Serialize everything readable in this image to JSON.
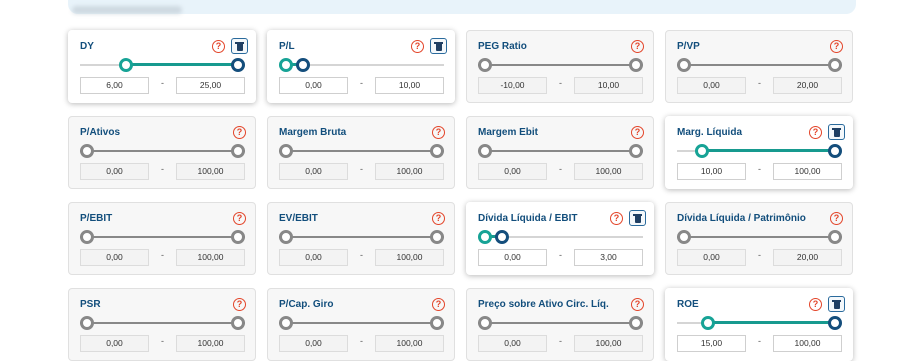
{
  "filters": [
    {
      "key": "dy",
      "name": "DY",
      "active": true,
      "min": "6,00",
      "max": "25,00",
      "lo": 0.26,
      "hi": 1.0
    },
    {
      "key": "pl",
      "name": "P/L",
      "active": true,
      "min": "0,00",
      "max": "10,00",
      "lo": 0.0,
      "hi": 0.11
    },
    {
      "key": "peg-ratio",
      "name": "PEG Ratio",
      "active": false,
      "min": "-10,00",
      "max": "10,00",
      "lo": 0,
      "hi": 1
    },
    {
      "key": "pvp",
      "name": "P/VP",
      "active": false,
      "min": "0,00",
      "max": "20,00",
      "lo": 0,
      "hi": 1
    },
    {
      "key": "p-ativos",
      "name": "P/Ativos",
      "active": false,
      "min": "0,00",
      "max": "100,00",
      "lo": 0,
      "hi": 1
    },
    {
      "key": "margem-bruta",
      "name": "Margem Bruta",
      "active": false,
      "min": "0,00",
      "max": "100,00",
      "lo": 0,
      "hi": 1
    },
    {
      "key": "margem-ebit",
      "name": "Margem Ebit",
      "active": false,
      "min": "0,00",
      "max": "100,00",
      "lo": 0,
      "hi": 1
    },
    {
      "key": "marg-liquida",
      "name": "Marg. Líquida",
      "active": true,
      "min": "10,00",
      "max": "100,00",
      "lo": 0.12,
      "hi": 1.0
    },
    {
      "key": "p-ebit",
      "name": "P/EBIT",
      "active": false,
      "min": "0,00",
      "max": "100,00",
      "lo": 0,
      "hi": 1
    },
    {
      "key": "ev-ebit",
      "name": "EV/EBIT",
      "active": false,
      "min": "0,00",
      "max": "100,00",
      "lo": 0,
      "hi": 1
    },
    {
      "key": "divida-liquida-ebit",
      "name": "Dívida Líquida / EBIT",
      "active": true,
      "min": "0,00",
      "max": "3,00",
      "lo": 0.0,
      "hi": 0.11
    },
    {
      "key": "divida-liquida-patrimonio",
      "name": "Dívida Líquida / Patrimônio",
      "active": false,
      "min": "0,00",
      "max": "20,00",
      "lo": 0,
      "hi": 1
    },
    {
      "key": "psr",
      "name": "PSR",
      "active": false,
      "min": "0,00",
      "max": "100,00",
      "lo": 0,
      "hi": 1
    },
    {
      "key": "p-cap-giro",
      "name": "P/Cap. Giro",
      "active": false,
      "min": "0,00",
      "max": "100,00",
      "lo": 0,
      "hi": 1
    },
    {
      "key": "preco-ativo-circ-liq",
      "name": "Preço sobre Ativo Circ. Líq.",
      "active": false,
      "min": "0,00",
      "max": "100,00",
      "lo": 0,
      "hi": 1
    },
    {
      "key": "roe",
      "name": "ROE",
      "active": true,
      "min": "15,00",
      "max": "100,00",
      "lo": 0.16,
      "hi": 1.0
    }
  ],
  "labels": {
    "help_glyph": "?",
    "separator": "-"
  },
  "icons": {
    "help": "help-circle-icon",
    "remove": "trash-icon"
  },
  "colors": {
    "title": "#124e7c",
    "help": "#e3452a",
    "fill": "#179a8f",
    "thumb_low": "#17a396",
    "thumb_high": "#144e7c",
    "inactive_track": "#888888"
  }
}
